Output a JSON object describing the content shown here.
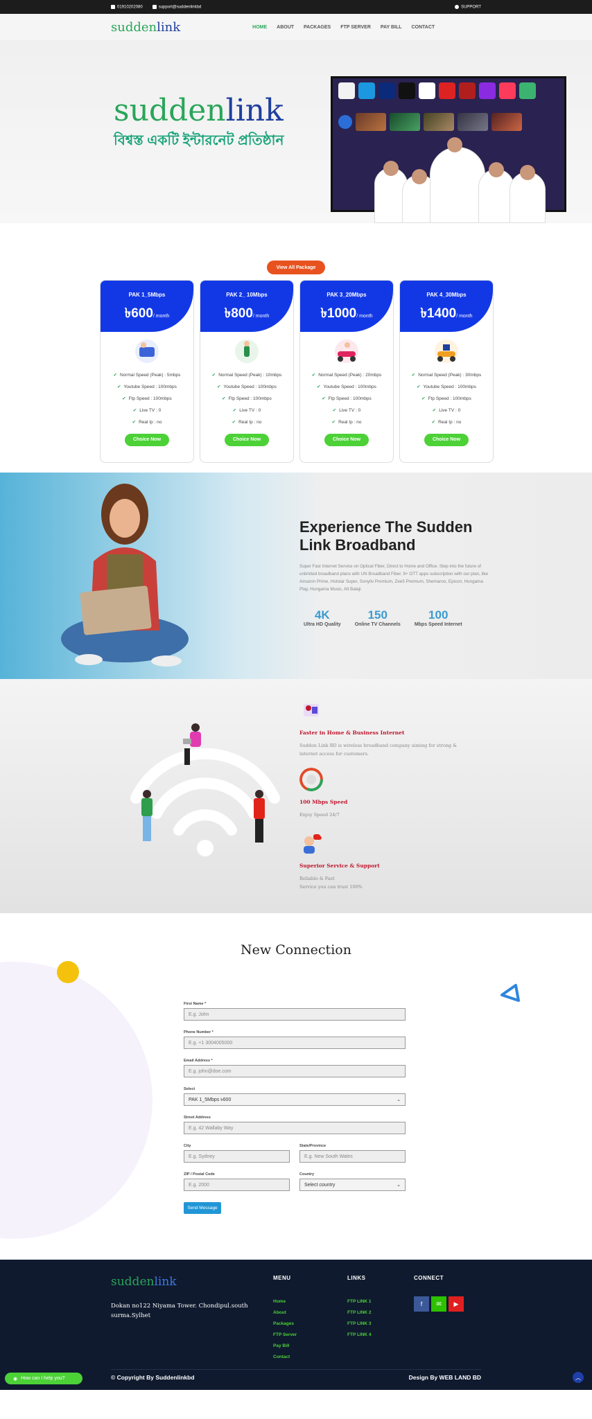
{
  "topbar": {
    "phone": "01910202080",
    "email": "support@suddenlinkbd",
    "support": "SUPPORT"
  },
  "nav": {
    "logo_a": "sudden",
    "logo_b": "link",
    "items": [
      "HOME",
      "ABOUT",
      "PACKAGES",
      "FTP SERVER",
      "PAY BILL",
      "CONTACT"
    ]
  },
  "hero": {
    "logo_a": "sudden",
    "logo_b": "link",
    "tagline": "বিশ্বস্ত একটি ইন্টারনেট প্রতিষ্ঠান"
  },
  "packages": {
    "view_all": "View All Package",
    "items": [
      {
        "name": "PAK 1_5Mbps",
        "price": "৳600",
        "period": "/ month",
        "speed": "Normal Speed (Peak) : 5mbps",
        "youtube": "Youtube Speed : 100mbps",
        "ftp": "Ftp Speed : 100mbps",
        "livetv": "Live TV : 0",
        "realip": "Real Ip : no",
        "cta": "Choice Now"
      },
      {
        "name": "PAK 2_ 10Mbps",
        "price": "৳800",
        "period": "/ month",
        "speed": "Normal Speed (Peak) : 10mbps",
        "youtube": "Youtube Speed : 100mbps",
        "ftp": "Ftp Speed : 100mbps",
        "livetv": "Live TV : 0",
        "realip": "Real Ip : no",
        "cta": "Choice Now"
      },
      {
        "name": "PAK 3_20Mbps",
        "price": "৳1000",
        "period": "/ month",
        "speed": "Normal Speed (Peak) : 20mbps",
        "youtube": "Youtube Speed : 100mbps",
        "ftp": "Ftp Speed : 100mbps",
        "livetv": "Live TV : 0",
        "realip": "Real Ip : no",
        "cta": "Choice Now"
      },
      {
        "name": "PAK 4_30Mbps",
        "price": "৳1400",
        "period": "/ month",
        "speed": "Normal Speed (Peak) : 30mbps",
        "youtube": "Youtube Speed : 100mbps",
        "ftp": "Ftp Speed : 100mbps",
        "livetv": "Live TV : 0",
        "realip": "Real Ip : no",
        "cta": "Choice Now"
      }
    ]
  },
  "experience": {
    "title": "Experience The Sudden Link Broadband",
    "text": "Super Fast Internet Service on Optical Fiber, Direct to Home and Office. Step into the future of unlimited broadband plans with UN Broadband Fiber. 9+ OTT apps subscription with our plan, like Amazon Prime, Hotstar Super, Sonyliv Premium, Zee5 Premium, Shemaroo, Epicon, Hungama Play, Hungama Music, Alt Balaji.",
    "stats": [
      {
        "num": "4K",
        "label": "Ultra HD Quality"
      },
      {
        "num": "150",
        "label": "Online TV Channels"
      },
      {
        "num": "100",
        "label": "Mbps Speed Internet"
      }
    ]
  },
  "features": [
    {
      "title": "Faster in Home & Business Internet",
      "text": "Sudden Link BD is wireless broadband company aiming for strong & internet access for customers."
    },
    {
      "title": "100 Mbps Speed",
      "text": "Enjoy Speed 24/7"
    },
    {
      "title": "Superior Service & Support",
      "text": "Reliable & Fast",
      "text2": "Service you can trust 100%"
    }
  ],
  "connection": {
    "title": "New Connection",
    "first_name": {
      "label": "First Name *",
      "placeholder": "E.g. John"
    },
    "phone": {
      "label": "Phone Number *",
      "placeholder": "E.g. +1 3004005000"
    },
    "email": {
      "label": "Email Address *",
      "placeholder": "E.g. john@doe.com"
    },
    "select": {
      "label": "Select",
      "value": "PAK 1_5Mbps ৳600"
    },
    "street": {
      "label": "Street Address",
      "placeholder": "E.g. 42 Wallaby Way"
    },
    "city": {
      "label": "City",
      "placeholder": "E.g. Sydney"
    },
    "state": {
      "label": "State/Province",
      "placeholder": "E.g. New South Wales"
    },
    "zip": {
      "label": "ZIP / Postal Code",
      "placeholder": "E.g. 2000"
    },
    "country": {
      "label": "Country",
      "value": "Select country"
    },
    "submit": "Send Message"
  },
  "footer": {
    "logo_a": "sudden",
    "logo_b": "link",
    "address": "Dokan no122 Niyama Tower. Chondipul.south surma.Sylhet",
    "menu_title": "MENU",
    "menu": [
      "Home",
      "About",
      "Packages",
      "FTP Server",
      "Pay Bill",
      "Contact"
    ],
    "links_title": "LINKS",
    "links": [
      "FTP LINK 1",
      "FTP LINK 2",
      "FTP LINK 3",
      "FTP LINK 4"
    ],
    "connect_title": "CONNECT",
    "copyright": "© Copyright By Suddenlinkbd",
    "design": "Design By WEB LAND BD",
    "whatsapp": "How can I help you?"
  },
  "colors": {
    "brand_green": "#2aa55a",
    "brand_blue": "#1238e6",
    "orange": "#e8521e",
    "button_green": "#4cd137",
    "footer_bg": "#0f1a2e"
  }
}
